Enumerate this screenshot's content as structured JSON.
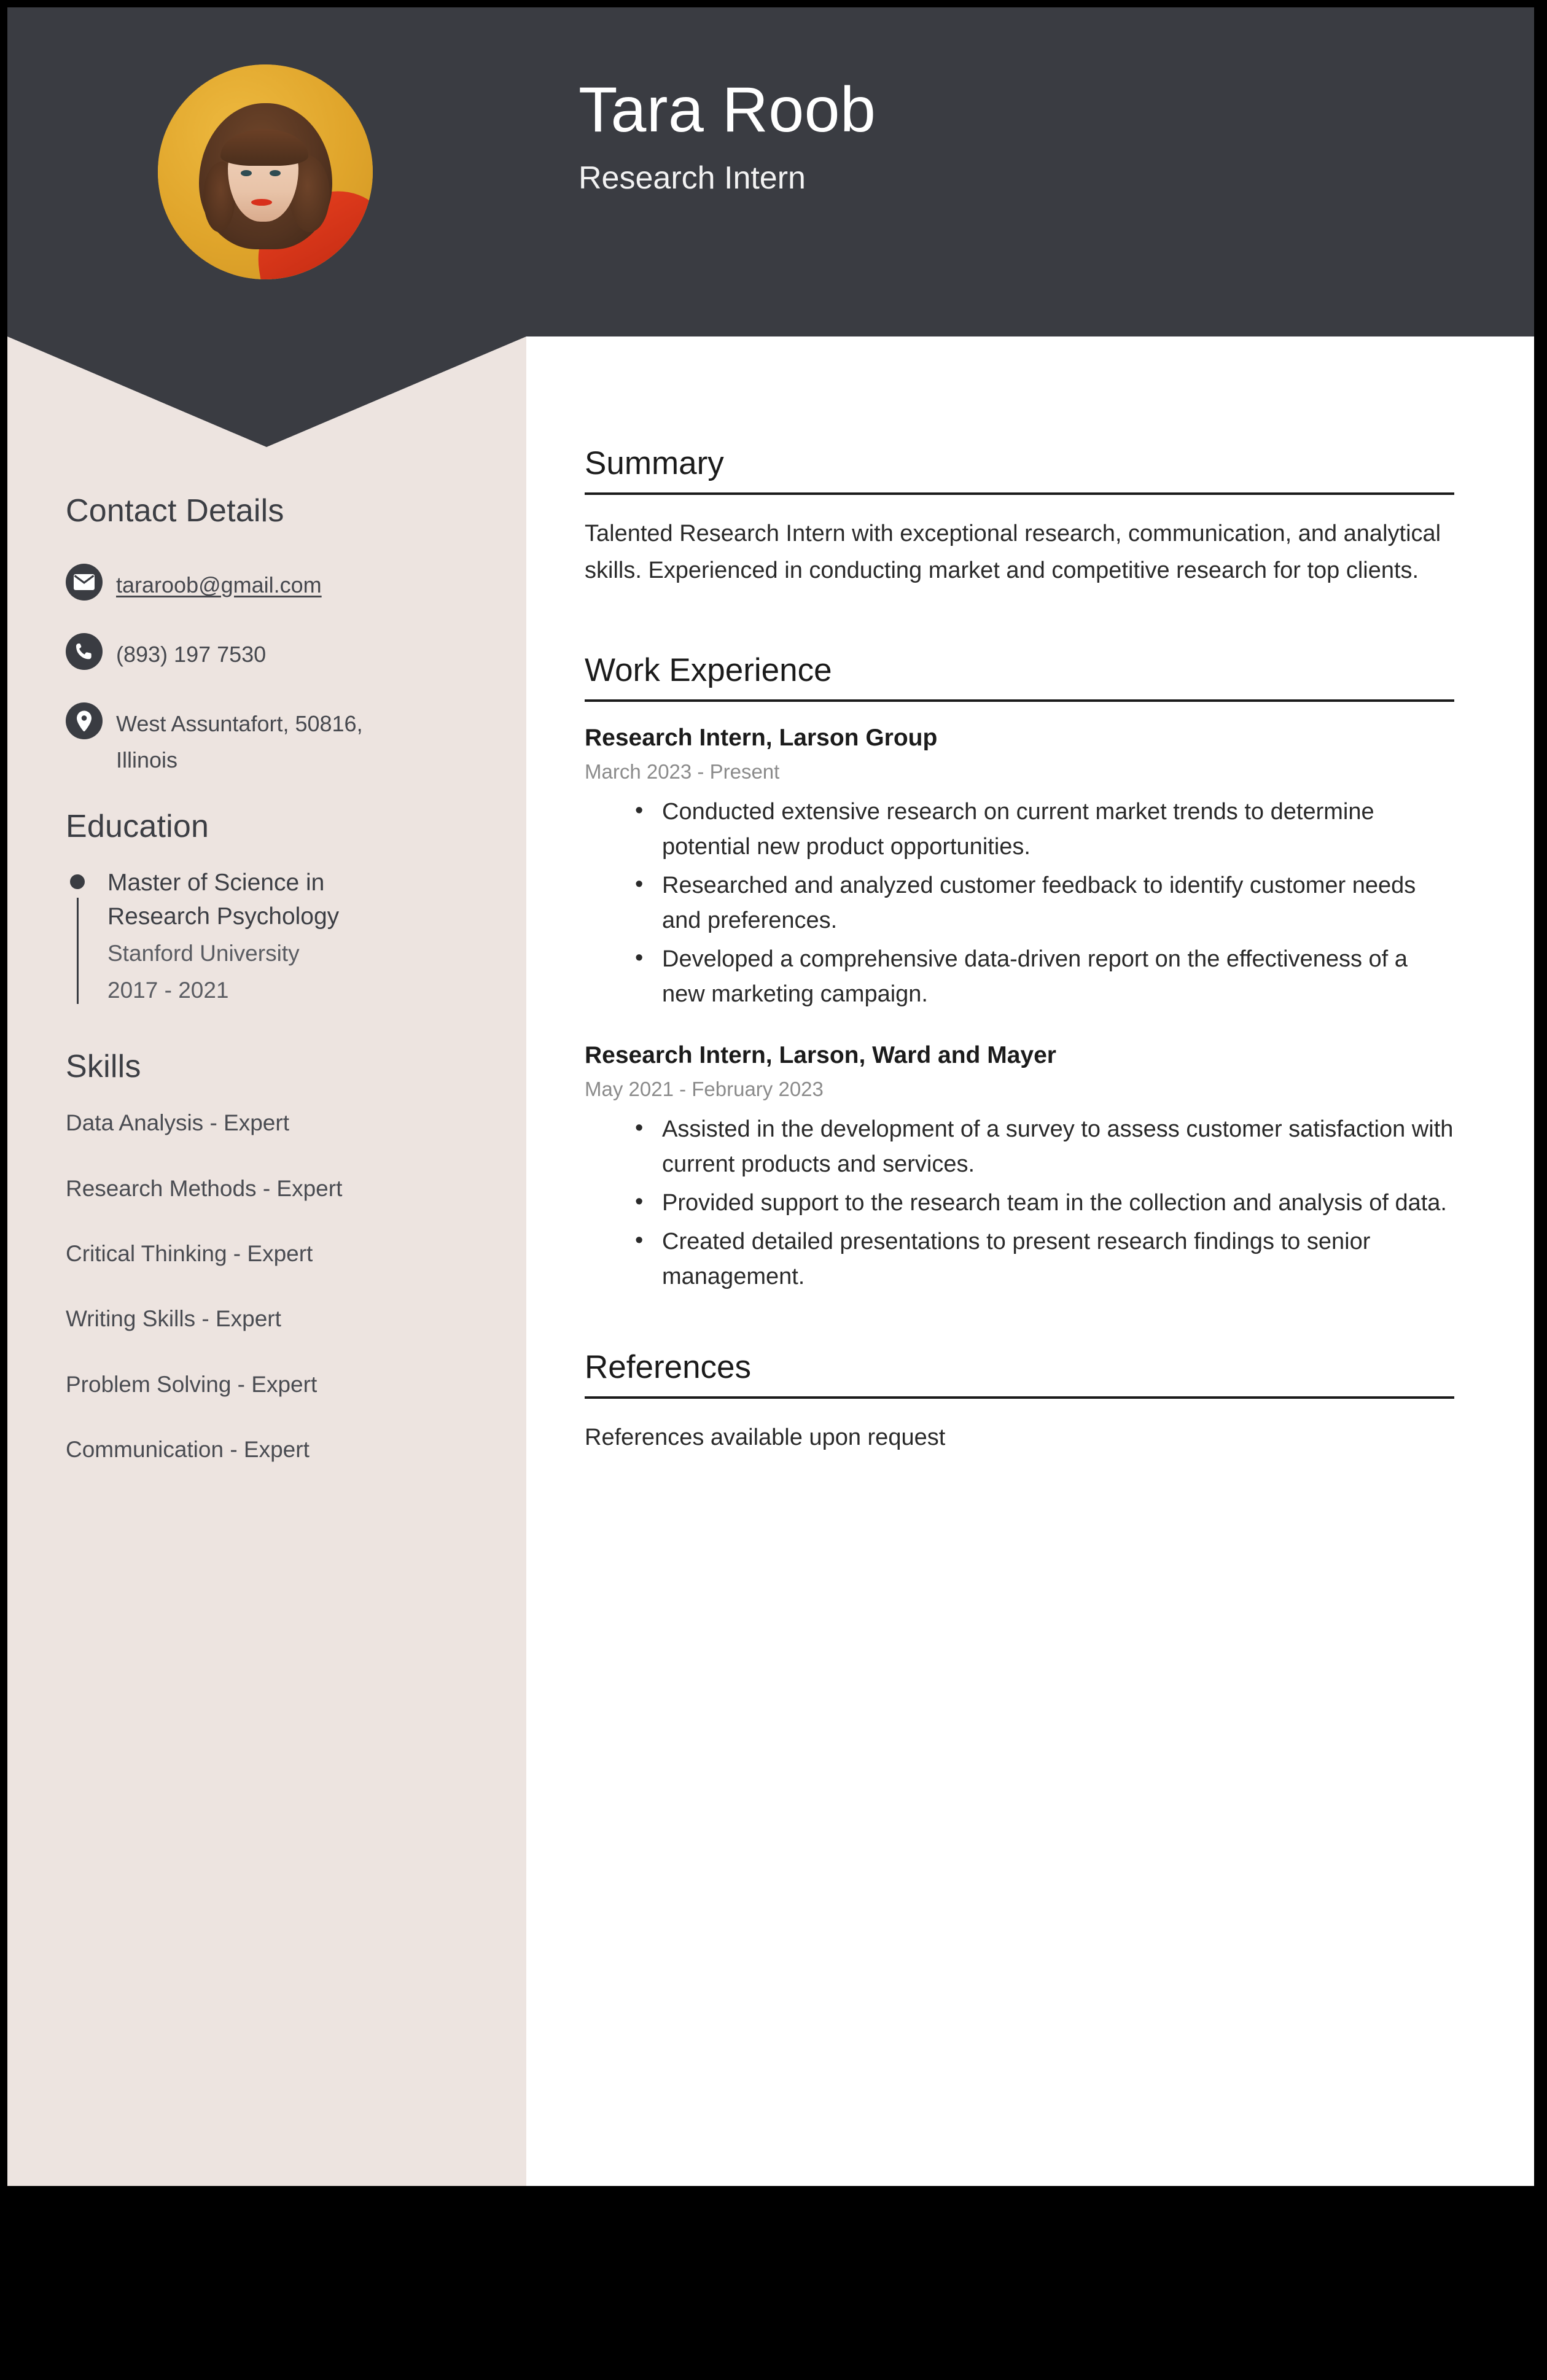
{
  "colors": {
    "header_bg": "#3a3c42",
    "sidebar_bg": "#ede4e0",
    "main_bg": "#ffffff",
    "accent_photo": "#e0a52b",
    "text_dark": "#1b1b1b",
    "text_muted": "#8b8b8b",
    "page_frame": "#000000"
  },
  "header": {
    "name": "Tara Roob",
    "job_title": "Research Intern",
    "avatar_alt": "profile-photo"
  },
  "sidebar": {
    "contact": {
      "heading": "Contact Details",
      "items": [
        {
          "icon": "envelope-icon",
          "value": "tararoob@gmail.com",
          "is_link": true
        },
        {
          "icon": "phone-icon",
          "value": "(893) 197 7530",
          "is_link": false
        },
        {
          "icon": "location-pin-icon",
          "value": "West Assuntafort, 50816, Illinois",
          "is_link": false
        }
      ]
    },
    "education": {
      "heading": "Education",
      "items": [
        {
          "degree": "Master of Science in Research Psychology",
          "school": "Stanford University",
          "dates": "2017 - 2021"
        }
      ]
    },
    "skills": {
      "heading": "Skills",
      "items": [
        "Data Analysis - Expert",
        "Research Methods - Expert",
        "Critical Thinking - Expert",
        "Writing Skills - Expert",
        "Problem Solving - Expert",
        "Communication - Expert"
      ]
    }
  },
  "main": {
    "summary": {
      "heading": "Summary",
      "text": "Talented Research Intern with exceptional research, communication, and analytical skills. Experienced in conducting market and competitive research for top clients."
    },
    "work_experience": {
      "heading": "Work Experience",
      "jobs": [
        {
          "title": "Research Intern, Larson Group",
          "dates": "March 2023 - Present",
          "bullets": [
            "Conducted extensive research on current market trends to determine potential new product opportunities.",
            "Researched and analyzed customer feedback to identify customer needs and preferences.",
            "Developed a comprehensive data-driven report on the effectiveness of a new marketing campaign."
          ]
        },
        {
          "title": "Research Intern, Larson, Ward and Mayer",
          "dates": "May 2021 - February 2023",
          "bullets": [
            "Assisted in the development of a survey to assess customer satisfaction with current products and services.",
            "Provided support to the research team in the collection and analysis of data.",
            "Created detailed presentations to present research findings to senior management."
          ]
        }
      ]
    },
    "references": {
      "heading": "References",
      "text": "References available upon request"
    }
  }
}
